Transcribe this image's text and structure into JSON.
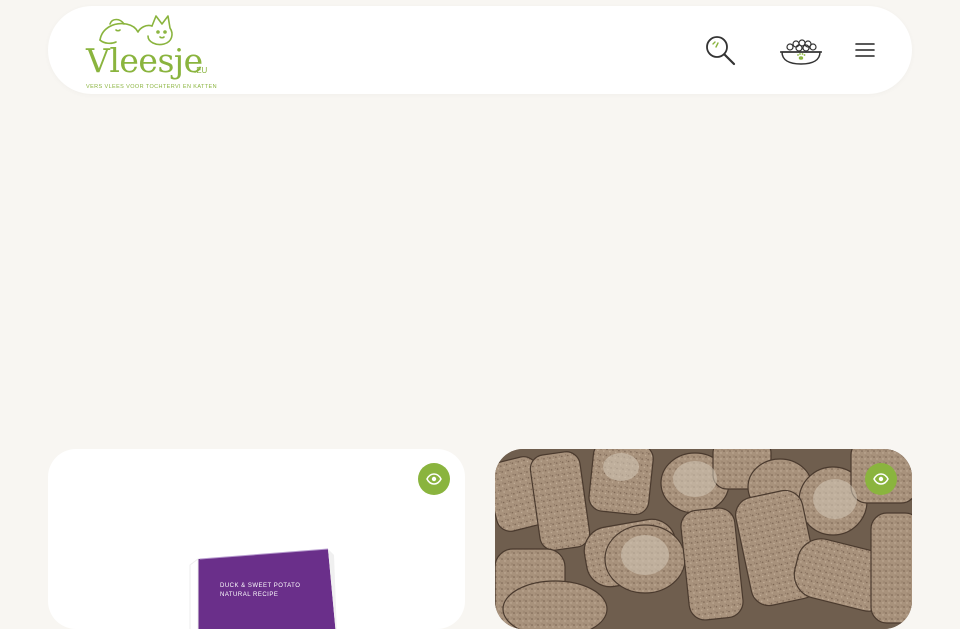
{
  "brand": {
    "name": "Vleesje",
    "suffix": ".EU",
    "tagline": "Vers vlees voor Tochtervi en katten",
    "color": "#8ab43e"
  },
  "header": {
    "icons": [
      "search-icon",
      "food-bowl-icon",
      "hamburger-menu-icon"
    ]
  },
  "products": [
    {
      "image": "Duck & Sweet Potato bag",
      "package_text_1": "DUCK & SWEET POTATO",
      "package_text_2": "NATURAL RECIPE",
      "package_color": "#6a2f8a",
      "icon": "eye-icon"
    },
    {
      "image": "meat rolls",
      "icon": "eye-icon"
    }
  ],
  "colors": {
    "accent": "#8ab43e",
    "background": "#f8f6f2",
    "icon_stroke": "#333333"
  }
}
